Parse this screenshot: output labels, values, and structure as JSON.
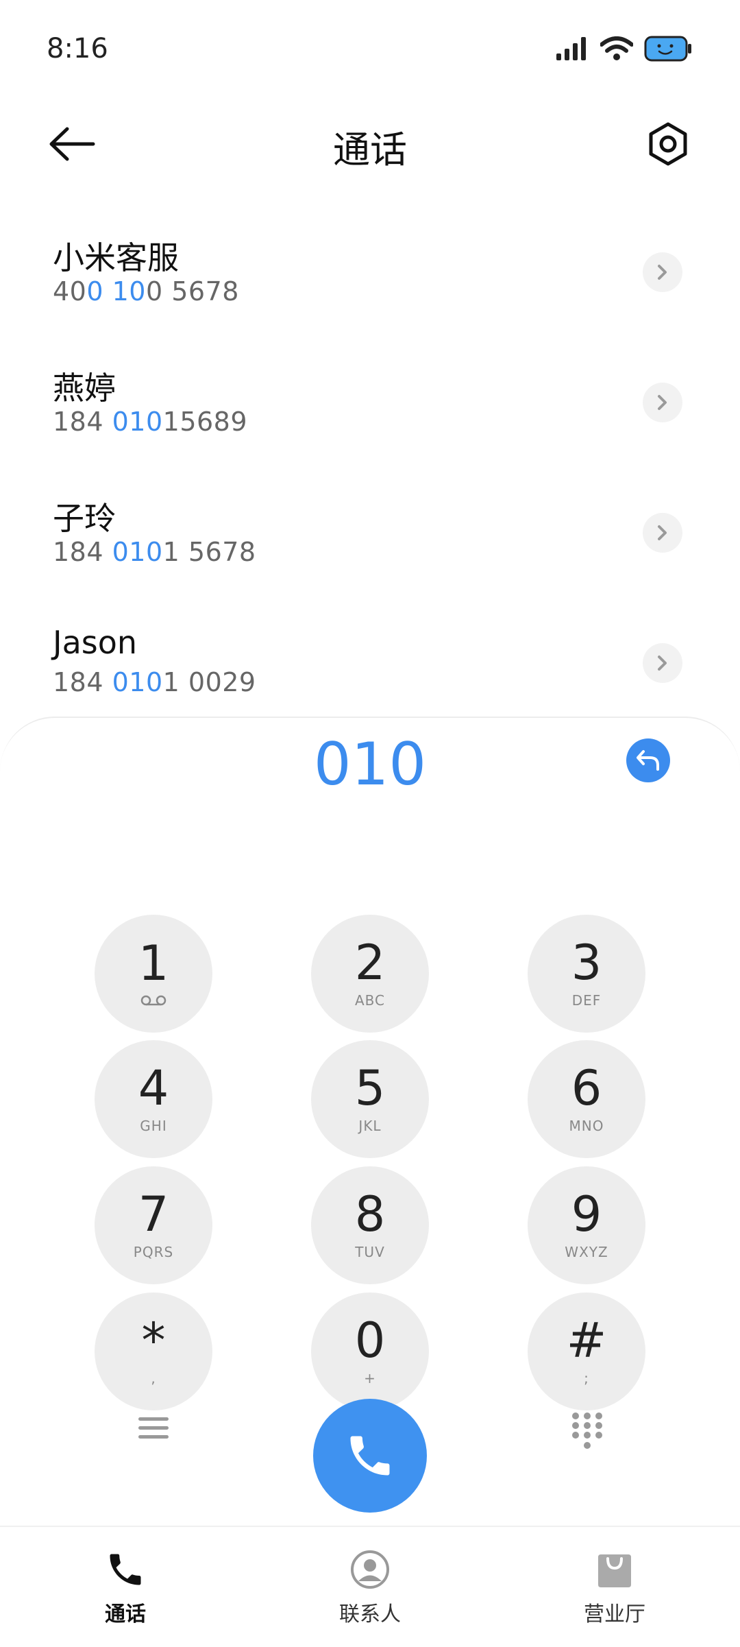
{
  "status_bar": {
    "time": "8:16"
  },
  "header": {
    "title": "通话"
  },
  "results": [
    {
      "name": "小米客服",
      "number_parts": [
        "40",
        "0 10",
        "0 5678"
      ]
    },
    {
      "name": "燕婷",
      "number_parts": [
        "184 ",
        "010",
        "15689"
      ]
    },
    {
      "name": "子玲",
      "number_parts": [
        "184 ",
        "010",
        "1 5678"
      ]
    },
    {
      "name": "Jason",
      "number_parts": [
        "184 ",
        "010",
        "1 0029"
      ]
    }
  ],
  "dialer": {
    "digits": "010"
  },
  "keys": [
    {
      "digit": "1",
      "letters": ""
    },
    {
      "digit": "2",
      "letters": "ABC"
    },
    {
      "digit": "3",
      "letters": "DEF"
    },
    {
      "digit": "4",
      "letters": "GHI"
    },
    {
      "digit": "5",
      "letters": "JKL"
    },
    {
      "digit": "6",
      "letters": "MNO"
    },
    {
      "digit": "7",
      "letters": "PQRS"
    },
    {
      "digit": "8",
      "letters": "TUV"
    },
    {
      "digit": "9",
      "letters": "WXYZ"
    },
    {
      "digit": "*",
      "letters": ","
    },
    {
      "digit": "0",
      "letters": "+"
    },
    {
      "digit": "#",
      "letters": ";"
    }
  ],
  "bottom_nav": {
    "calls": "通话",
    "contacts": "联系人",
    "store": "营业厅"
  },
  "colors": {
    "accent": "#3c8cee",
    "key_bg": "#ededed"
  }
}
